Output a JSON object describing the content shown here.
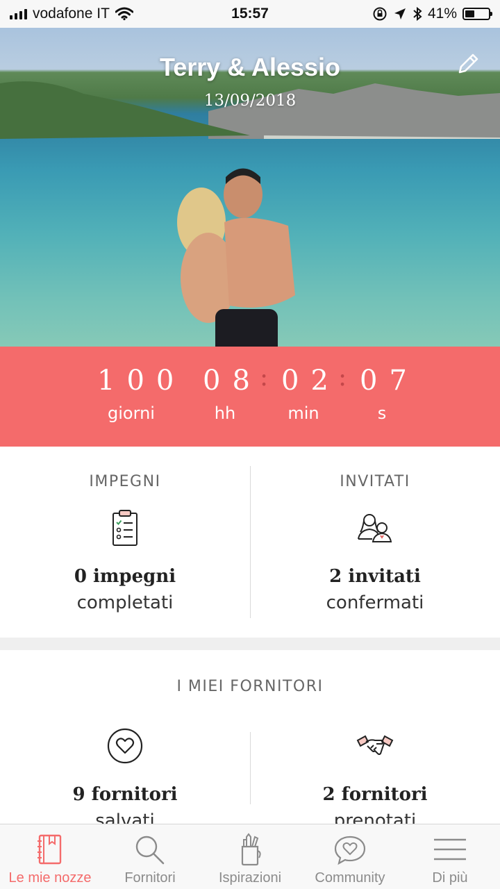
{
  "status_bar": {
    "carrier": "vodafone IT",
    "time": "15:57",
    "battery": "41%",
    "battery_level": 0.41
  },
  "hero": {
    "title": "Terry & Alessio",
    "date": "13/09/2018"
  },
  "countdown": {
    "days": "100",
    "hours": "08",
    "minutes": "02",
    "seconds": "07",
    "separator": ":",
    "days_label": "giorni",
    "hours_label": "hh",
    "minutes_label": "min",
    "seconds_label": "s"
  },
  "tasks": {
    "heading": "IMPEGNI",
    "count": "0 impegni",
    "status": "completati"
  },
  "guests": {
    "heading": "INVITATI",
    "count": "2 invitati",
    "status": "confermati"
  },
  "suppliers": {
    "heading": "I MIEI FORNITORI",
    "saved_count": "9 fornitori",
    "saved_status": "salvati",
    "booked_count": "2 fornitori",
    "booked_status": "prenotati"
  },
  "tabbar": {
    "items": [
      {
        "label": "Le mie nozze",
        "icon": "notebook-icon",
        "active": true
      },
      {
        "label": "Fornitori",
        "icon": "search-icon",
        "active": false
      },
      {
        "label": "Ispirazioni",
        "icon": "pencil-cup-icon",
        "active": false
      },
      {
        "label": "Community",
        "icon": "chat-heart-icon",
        "active": false
      },
      {
        "label": "Di più",
        "icon": "menu-icon",
        "active": false
      }
    ]
  },
  "colors": {
    "accent": "#f46b6b",
    "countdown_separator": "#c4474a",
    "tab_inactive": "#8b8b8b"
  }
}
